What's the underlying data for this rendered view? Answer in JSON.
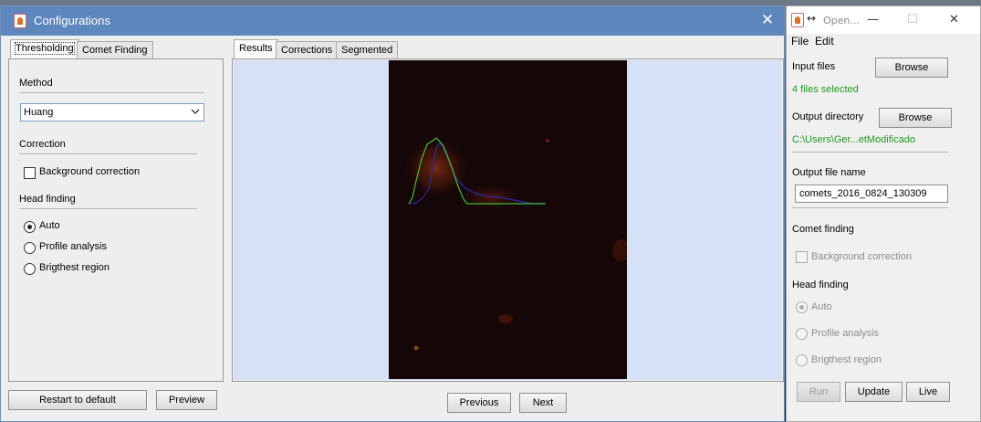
{
  "config_window": {
    "title": "Configurations",
    "left_tabs": [
      "Thresholding",
      "Comet Finding"
    ],
    "method_label": "Method",
    "method_value": "Huang",
    "correction_label": "Correction",
    "background_correction_label": "Background correction",
    "background_correction_checked": false,
    "head_finding_label": "Head finding",
    "head_options": [
      "Auto",
      "Profile analysis",
      "Brigthest region"
    ],
    "head_selected": "Auto",
    "restart_label": "Restart to default",
    "preview_label": "Preview",
    "right_tabs": [
      "Results",
      "Corrections",
      "Segmented"
    ],
    "previous_label": "Previous",
    "next_label": "Next"
  },
  "open_window": {
    "title": "Open...",
    "menu": [
      "File",
      "Edit"
    ],
    "input_files_label": "Input files",
    "browse_label": "Browse",
    "files_selected": "4 files selected",
    "output_dir_label": "Output directory",
    "output_dir_value": "C:\\Users\\Ger...etModificado",
    "output_file_label": "Output file name",
    "output_file_value": "comets_2016_0824_130309",
    "comet_finding_label": "Comet finding",
    "background_correction_label": "Background correction",
    "head_finding_label": "Head finding",
    "head_options": [
      "Auto",
      "Profile analysis",
      "Brigthest region"
    ],
    "run_label": "Run",
    "update_label": "Update",
    "live_label": "Live"
  },
  "colors": {
    "titlebar": "#5e87bd",
    "status_green": "#1e9b1e",
    "image_background": "#d6e1f6",
    "profile_green": "#3fbf3f",
    "profile_blue": "#2a2aa8"
  }
}
